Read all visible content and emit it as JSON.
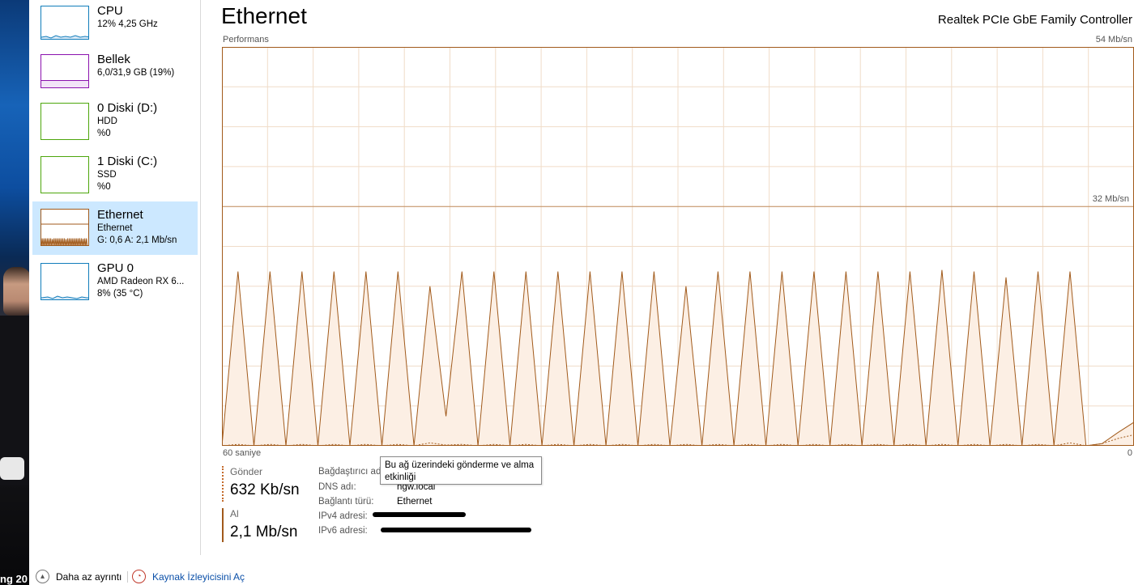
{
  "background": {
    "overlay_text": "ng 20"
  },
  "sidebar": {
    "items": [
      {
        "title": "CPU",
        "line2": "12%  4,25 GHz",
        "line3": "",
        "color": "#117dbb"
      },
      {
        "title": "Bellek",
        "line2": "6,0/31,9 GB (19%)",
        "line3": "",
        "color": "#8b12ae"
      },
      {
        "title": "0 Diski (D:)",
        "line2": "HDD",
        "line3": "%0",
        "color": "#4da60c"
      },
      {
        "title": "1 Diski (C:)",
        "line2": "SSD",
        "line3": "%0",
        "color": "#4da60c"
      },
      {
        "title": "Ethernet",
        "line2": "Ethernet",
        "line3": "G: 0,6  A: 2,1 Mb/sn",
        "color": "#a15a1b"
      },
      {
        "title": "GPU 0",
        "line2": "AMD Radeon RX 6...",
        "line3": "8%  (35 °C)",
        "color": "#117dbb"
      }
    ]
  },
  "main": {
    "title": "Ethernet",
    "adapter": "Realtek PCIe GbE Family Controller",
    "perf_label": "Performans",
    "scale_top": "54 Mb/sn",
    "scale_mid": "32 Mb/sn",
    "x_left": "60 saniye",
    "x_right": "0"
  },
  "stats": {
    "send_label": "Gönder",
    "send_value": "632 Kb/sn",
    "recv_label": "Al",
    "recv_value": "2,1 Mb/sn"
  },
  "properties": {
    "adapter_name_label": "Bağdaştırıcı adı:",
    "dns_label": "DNS adı:",
    "dns_value": "hgw.local",
    "conn_type_label": "Bağlantı türü:",
    "conn_type_value": "Ethernet",
    "ipv4_label": "IPv4 adresi:",
    "ipv6_label": "IPv6 adresi:"
  },
  "tooltip": {
    "text": "Bu ağ üzerindeki gönderme ve alma etkinliği"
  },
  "footer": {
    "fewer_details": "Daha az ayrıntı",
    "open_resmon": "Kaynak İzleyicisini Aç"
  },
  "colors": {
    "ethernet": "#a15a1b",
    "ethernet_fill": "#fcefe4",
    "grid": "#f0dcc8",
    "selected": "#cce8ff"
  },
  "chart_data": {
    "type": "line",
    "x_range_seconds": [
      60,
      0
    ],
    "ylim": [
      0,
      54
    ],
    "y_unit": "Mb/sn",
    "grid": true,
    "series": [
      {
        "values": [
          0,
          23.6,
          0,
          23.6,
          0,
          23.6,
          0,
          23.6,
          0,
          23.6,
          0,
          23.6,
          0,
          21.6,
          4.0,
          23.6,
          0,
          23.6,
          0,
          23.6,
          0,
          23.6,
          0,
          23.6,
          0,
          23.6,
          0,
          23.6,
          0,
          21.6,
          0,
          23.6,
          0,
          23.6,
          0,
          23.6,
          0,
          23.6,
          0,
          23.6,
          0,
          23.6,
          0,
          23.6,
          0,
          23.8,
          0,
          23.6,
          0,
          22.8,
          0,
          23.6,
          0,
          23.6,
          0,
          0.3,
          1.8,
          3.2
        ]
      },
      {
        "values": [
          0,
          0.2,
          0,
          0.2,
          0,
          0.2,
          0,
          0.2,
          0,
          0.2,
          0,
          0.2,
          0,
          0.4,
          0.1,
          0.2,
          0,
          0.2,
          0,
          0.2,
          0,
          0.2,
          0,
          0.2,
          0,
          0.2,
          0,
          0.2,
          0,
          0.2,
          0,
          0.2,
          0,
          0.2,
          0,
          0.2,
          0,
          0.2,
          0,
          0.2,
          0,
          0.2,
          0,
          0.2,
          0,
          0.2,
          0,
          0.2,
          0,
          0.2,
          0,
          0.2,
          0,
          0.4,
          0,
          0.3,
          1.0,
          1.5
        ]
      }
    ]
  }
}
